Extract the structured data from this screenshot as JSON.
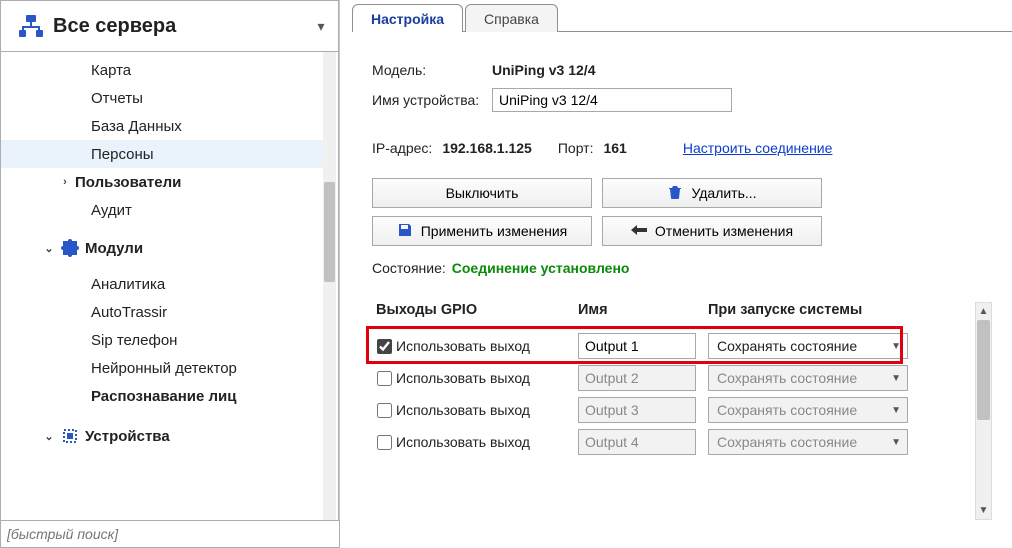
{
  "sidebar": {
    "header_title": "Все сервера",
    "search_placeholder": "[быстрый поиск]",
    "items": [
      {
        "label": "Карта",
        "bold": false,
        "indent": "indent-2",
        "expander": "",
        "icon": ""
      },
      {
        "label": "Отчеты",
        "bold": false,
        "indent": "indent-2",
        "expander": "",
        "icon": ""
      },
      {
        "label": "База Данных",
        "bold": false,
        "indent": "indent-2",
        "expander": "",
        "icon": ""
      },
      {
        "label": "Персоны",
        "bold": false,
        "indent": "indent-2",
        "expander": "",
        "icon": "",
        "selected": true
      },
      {
        "label": "Пользователи",
        "bold": true,
        "indent": "indent-2x",
        "expander": "›",
        "icon": ""
      },
      {
        "label": "Аудит",
        "bold": false,
        "indent": "indent-2",
        "expander": "",
        "icon": ""
      },
      {
        "label": "Модули",
        "bold": true,
        "indent": "indent-1",
        "expander": "⌄",
        "icon": "puzzle"
      },
      {
        "label": "Аналитика",
        "bold": false,
        "indent": "indent-2",
        "expander": "",
        "icon": ""
      },
      {
        "label": "AutoTrassir",
        "bold": false,
        "indent": "indent-2",
        "expander": "",
        "icon": ""
      },
      {
        "label": "Sip телефон",
        "bold": false,
        "indent": "indent-2",
        "expander": "",
        "icon": ""
      },
      {
        "label": "Нейронный детектор",
        "bold": false,
        "indent": "indent-2",
        "expander": "",
        "icon": ""
      },
      {
        "label": "Распознавание лиц",
        "bold": true,
        "indent": "indent-2",
        "expander": "",
        "icon": ""
      },
      {
        "label": "Устройства",
        "bold": true,
        "indent": "indent-1",
        "expander": "⌄",
        "icon": "chip"
      }
    ]
  },
  "tabs": {
    "settings": "Настройка",
    "help": "Справка"
  },
  "form": {
    "model_label": "Модель:",
    "model_value": "UniPing v3 12/4",
    "devname_label": "Имя устройства:",
    "devname_value": "UniPing v3 12/4",
    "ip_label": "IP-адрес:",
    "ip_value": "192.168.1.125",
    "port_label": "Порт:",
    "port_value": "161",
    "conn_link": "Настроить соединение"
  },
  "buttons": {
    "disable": "Выключить",
    "delete": "Удалить...",
    "apply": "Применить изменения",
    "revert": "Отменить изменения"
  },
  "status": {
    "label": "Состояние:",
    "value": "Соединение установлено"
  },
  "gpio": {
    "head_outputs": "Выходы GPIO",
    "head_name": "Имя",
    "head_onboot": "При запуске системы",
    "use_label": "Использовать выход",
    "rows": [
      {
        "checked": true,
        "name": "Output 1",
        "onboot": "Сохранять состояние",
        "enabled": true
      },
      {
        "checked": false,
        "name": "Output 2",
        "onboot": "Сохранять состояние",
        "enabled": false
      },
      {
        "checked": false,
        "name": "Output 3",
        "onboot": "Сохранять состояние",
        "enabled": false
      },
      {
        "checked": false,
        "name": "Output 4",
        "onboot": "Сохранять состояние",
        "enabled": false
      }
    ]
  }
}
